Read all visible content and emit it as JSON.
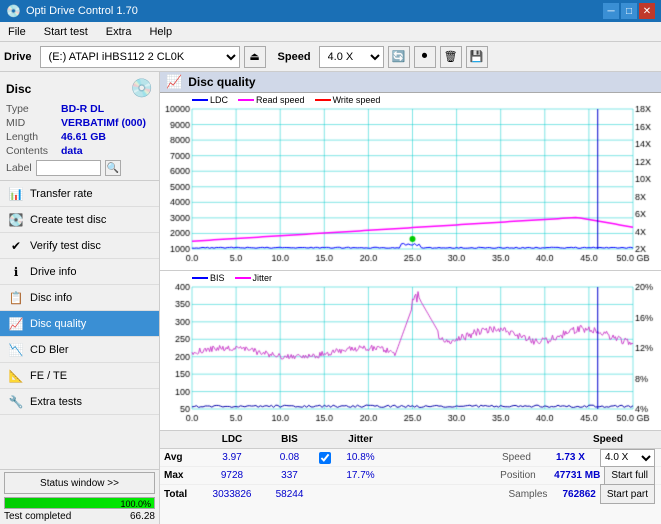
{
  "app": {
    "title": "Opti Drive Control 1.70",
    "icon": "💿"
  },
  "titlebar": {
    "minimize": "─",
    "maximize": "□",
    "close": "✕"
  },
  "menubar": {
    "items": [
      "File",
      "Start test",
      "Extra",
      "Help"
    ]
  },
  "toolbar": {
    "drive_label": "Drive",
    "drive_value": "(E:)  ATAPI iHBS112  2 CL0K",
    "speed_label": "Speed",
    "speed_value": "4.0 X"
  },
  "disc": {
    "title": "Disc",
    "type_label": "Type",
    "type_value": "BD-R DL",
    "mid_label": "MID",
    "mid_value": "VERBATIMf (000)",
    "length_label": "Length",
    "length_value": "46.61 GB",
    "contents_label": "Contents",
    "contents_value": "data",
    "label_label": "Label",
    "label_value": ""
  },
  "nav": {
    "items": [
      {
        "id": "transfer-rate",
        "label": "Transfer rate",
        "icon": "📊"
      },
      {
        "id": "create-test-disc",
        "label": "Create test disc",
        "icon": "💽"
      },
      {
        "id": "verify-test-disc",
        "label": "Verify test disc",
        "icon": "✔"
      },
      {
        "id": "drive-info",
        "label": "Drive info",
        "icon": "ℹ"
      },
      {
        "id": "disc-info",
        "label": "Disc info",
        "icon": "📋"
      },
      {
        "id": "disc-quality",
        "label": "Disc quality",
        "icon": "📈",
        "active": true
      },
      {
        "id": "cd-bler",
        "label": "CD Bler",
        "icon": "📉"
      },
      {
        "id": "fe-te",
        "label": "FE / TE",
        "icon": "📐"
      },
      {
        "id": "extra-tests",
        "label": "Extra tests",
        "icon": "🔧"
      }
    ]
  },
  "status": {
    "btn_label": "Status window >>",
    "progress": 100,
    "progress_text": "100.0%",
    "status_text": "Test completed",
    "value_text": "66.28"
  },
  "chart_header": {
    "title": "Disc quality"
  },
  "chart1": {
    "legend": [
      {
        "label": "LDC",
        "color": "#0000ff"
      },
      {
        "label": "Read speed",
        "color": "#ff00ff"
      },
      {
        "label": "Write speed",
        "color": "#ff0000"
      }
    ],
    "y_max": 10000,
    "y_labels": [
      "10000",
      "9000",
      "8000",
      "7000",
      "6000",
      "5000",
      "4000",
      "3000",
      "2000",
      "1000"
    ],
    "y2_labels": [
      "18X",
      "16X",
      "14X",
      "12X",
      "10X",
      "8X",
      "6X",
      "4X",
      "2X"
    ],
    "x_labels": [
      "0.0",
      "5.0",
      "10.0",
      "15.0",
      "20.0",
      "25.0",
      "30.0",
      "35.0",
      "40.0",
      "45.0",
      "50.0 GB"
    ]
  },
  "chart2": {
    "legend": [
      {
        "label": "BIS",
        "color": "#0000ff"
      },
      {
        "label": "Jitter",
        "color": "#ff00ff"
      }
    ],
    "y_max": 400,
    "y_labels": [
      "400",
      "350",
      "300",
      "250",
      "200",
      "150",
      "100",
      "50"
    ],
    "y2_labels": [
      "20%",
      "16%",
      "12%",
      "8%",
      "4%"
    ],
    "x_labels": [
      "0.0",
      "5.0",
      "10.0",
      "15.0",
      "20.0",
      "25.0",
      "30.0",
      "35.0",
      "40.0",
      "45.0",
      "50.0 GB"
    ]
  },
  "stats": {
    "col_headers": [
      "LDC",
      "BIS",
      "",
      "Jitter",
      "Speed",
      "",
      ""
    ],
    "rows": [
      {
        "label": "Avg",
        "ldc": "3.97",
        "bis": "0.08",
        "jitter": "10.8%"
      },
      {
        "label": "Max",
        "ldc": "9728",
        "bis": "337",
        "jitter": "17.7%"
      },
      {
        "label": "Total",
        "ldc": "3033826",
        "bis": "58244",
        "jitter": ""
      }
    ],
    "jitter_checked": true,
    "speed_label": "Speed",
    "speed_value": "1.73 X",
    "position_label": "Position",
    "position_value": "47731 MB",
    "samples_label": "Samples",
    "samples_value": "762862",
    "speed_select": "4.0 X",
    "start_full_label": "Start full",
    "start_part_label": "Start part"
  }
}
